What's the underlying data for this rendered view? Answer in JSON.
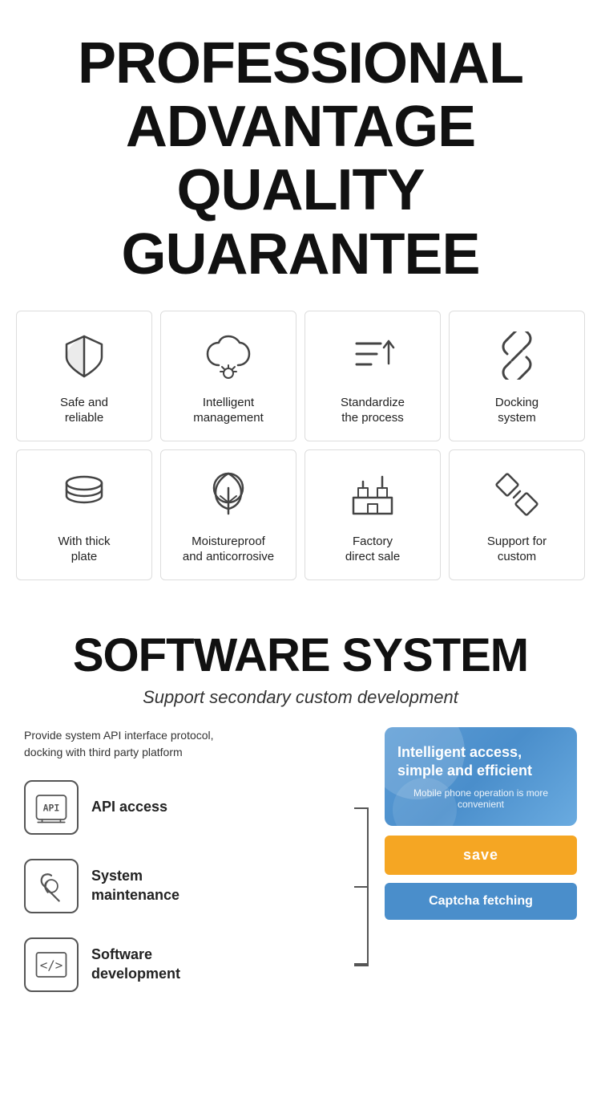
{
  "header": {
    "line1": "PROFESSIONAL",
    "line2": "ADVANTAGE",
    "line3": "QUALITY GUARANTEE"
  },
  "grid": {
    "row1": [
      {
        "id": "safe-reliable",
        "label": "Safe and\nreliable",
        "icon": "shield"
      },
      {
        "id": "intelligent-management",
        "label": "Intelligent\nmanagement",
        "icon": "cloud-settings"
      },
      {
        "id": "standardize-process",
        "label": "Standardize\nthe process",
        "icon": "checklist"
      },
      {
        "id": "docking-system",
        "label": "Docking\nsystem",
        "icon": "link"
      }
    ],
    "row2": [
      {
        "id": "thick-plate",
        "label": "With thick\nplate",
        "icon": "layers"
      },
      {
        "id": "moistureproof",
        "label": "Moistureproof\nand anticorrosive",
        "icon": "leaf"
      },
      {
        "id": "factory-sale",
        "label": "Factory\ndirect sale",
        "icon": "factory"
      },
      {
        "id": "support-custom",
        "label": "Support for\ncustom",
        "icon": "edit-tools"
      }
    ]
  },
  "software": {
    "title": "SOFTWARE SYSTEM",
    "subtitle": "Support secondary custom development",
    "description": "Provide system API interface protocol,\ndocking with third party platform",
    "features": [
      {
        "id": "api-access",
        "label": "API access",
        "icon": "api"
      },
      {
        "id": "system-maintenance",
        "label": "System\nmaintenance",
        "icon": "maintenance"
      },
      {
        "id": "software-development",
        "label": "Software\ndevelopment",
        "icon": "code"
      }
    ],
    "panel": {
      "title": "Intelligent access,\nsimple and efficient",
      "subtitle": "Mobile phone operation is more\nconvenient",
      "save_button": "save",
      "captcha_button": "Captcha fetching"
    }
  }
}
